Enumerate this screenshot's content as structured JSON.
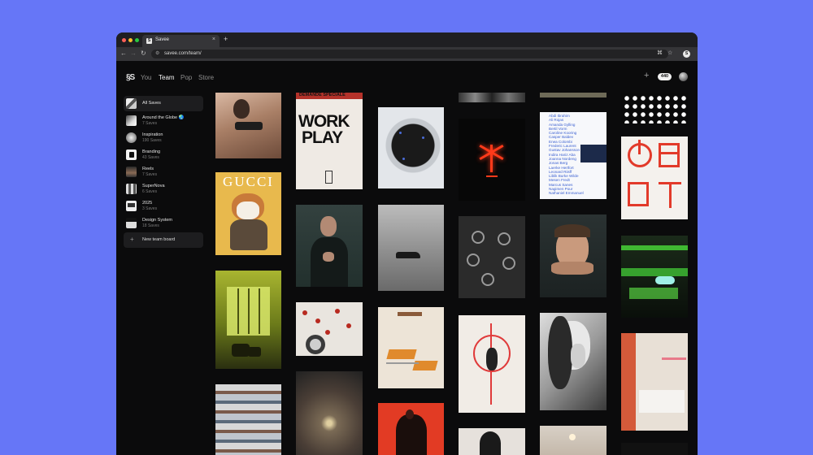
{
  "browser": {
    "tab_title": "Savee",
    "tab_favicon": "S",
    "tab_close": "×",
    "new_tab": "+",
    "url": "savee.com/team/",
    "back": "←",
    "forward": "→",
    "reload": "↻",
    "site_icon": "⚙",
    "translate_icon": "⌘",
    "star_icon": "☆",
    "profile": "S",
    "traffic_lights": [
      "#ff5f57",
      "#febc2e",
      "#28c840"
    ]
  },
  "header": {
    "logo": "§S",
    "nav": [
      {
        "label": "You",
        "active": false
      },
      {
        "label": "Team",
        "active": true
      },
      {
        "label": "Pop",
        "active": false
      },
      {
        "label": "Store",
        "active": false
      }
    ],
    "plus": "+",
    "count": "440"
  },
  "sidebar": {
    "items": [
      {
        "name": "All Saves",
        "count": "",
        "active": true
      },
      {
        "name": "Around the Globe 🌏",
        "count": "7 Saves"
      },
      {
        "name": "Inspiration",
        "count": "190 Saves"
      },
      {
        "name": "Branding",
        "count": "43 Saves"
      },
      {
        "name": "Reels",
        "count": "7 Saves"
      },
      {
        "name": "SuperNova",
        "count": "6 Saves"
      },
      {
        "name": "2025",
        "count": "3 Saves"
      },
      {
        "name": "Design System",
        "count": "18 Saves"
      }
    ],
    "new_board": {
      "icon": "+",
      "label": "New team board"
    }
  },
  "tiles": {
    "gucci": "GUCCI",
    "demande": "DEMANDE SPECIALE",
    "work": "WORK",
    "play": "PLAY",
    "names": [
      "Abdi Ibrahim",
      "Ali Rojas",
      "Amanda Gylling",
      "Bertil Vorm",
      "Caroline Kooring",
      "Casper Baldev",
      "Enea Colombi",
      "Frederic Laurent",
      "Gustav Johansson",
      "Indira Hariz Aba",
      "Joanna Nordeng",
      "Jonas Berg",
      "Laerke Hertfort",
      "Leonard Riisff",
      "Liblik Burke Wilde",
      "Mesen Fredt",
      "Marcus Sanes",
      "Nagimen Pour",
      "Nathaniel Emmanuel"
    ]
  }
}
